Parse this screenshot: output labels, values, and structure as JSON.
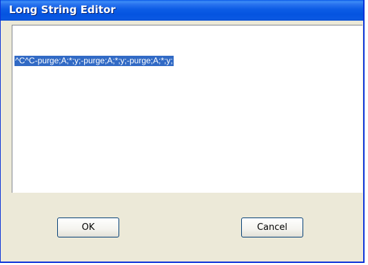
{
  "dialog": {
    "title": "Long String Editor",
    "editor_text": "^C^C-purge;A;*;y;-purge;A;*;y;-purge;A;*;y;",
    "ok_label": "OK",
    "cancel_label": "Cancel"
  },
  "colors": {
    "title_bar": "#0554e0",
    "selection": "#316ac5",
    "dialog_face": "#ece9d8",
    "button_border": "#003c74"
  }
}
